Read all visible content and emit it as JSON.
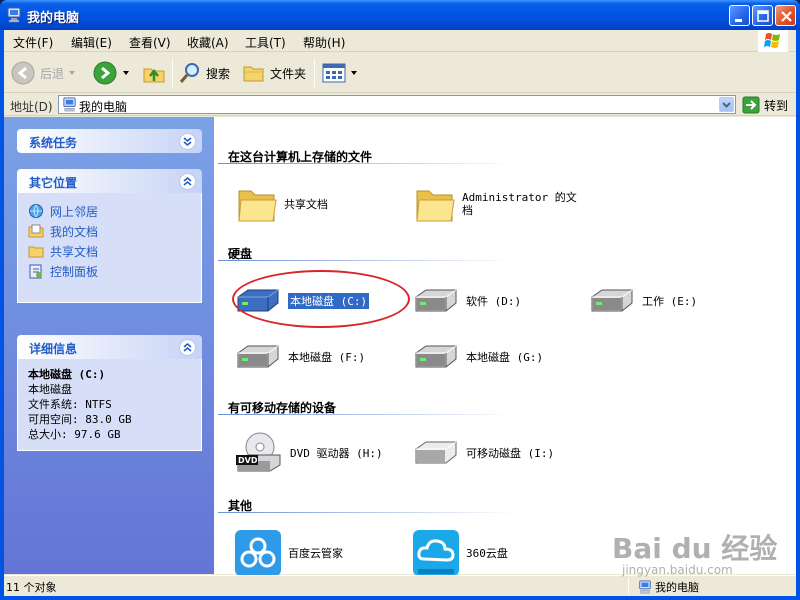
{
  "window": {
    "title": "我的电脑",
    "colors": {
      "titlebar": "#0055e5",
      "taskpane": "#6d8ee0",
      "link": "#215dc6",
      "selection": "#316ac5",
      "highlight_circle": "#d8252a"
    }
  },
  "menu": {
    "items": [
      "文件(F)",
      "编辑(E)",
      "查看(V)",
      "收藏(A)",
      "工具(T)",
      "帮助(H)"
    ]
  },
  "toolbar": {
    "back_label": "后退",
    "search_label": "搜索",
    "folders_label": "文件夹"
  },
  "address": {
    "label": "地址(D)",
    "value": "我的电脑",
    "go_label": "转到"
  },
  "taskpane": {
    "system_tasks_title": "系统任务",
    "other_places_title": "其它位置",
    "other_places": [
      "网上邻居",
      "我的文档",
      "共享文档",
      "控制面板"
    ],
    "details_title": "详细信息",
    "details": {
      "name": "本地磁盘 (C:)",
      "type": "本地磁盘",
      "filesystem": "文件系统: NTFS",
      "free": "可用空间: 83.0 GB",
      "total": "总大小: 97.6 GB"
    }
  },
  "content": {
    "groups": {
      "files": "在这台计算机上存储的文件",
      "hard_disks": "硬盘",
      "removable": "有可移动存储的设备",
      "other": "其他"
    },
    "files_items": [
      "共享文档",
      "Administrator 的文档"
    ],
    "disks": [
      "本地磁盘 (C:)",
      "软件 (D:)",
      "工作 (E:)",
      "本地磁盘 (F:)",
      "本地磁盘 (G:)"
    ],
    "removable_items": [
      "DVD 驱动器 (H:)",
      "可移动磁盘 (I:)"
    ],
    "other_items": [
      "百度云管家",
      "360云盘"
    ],
    "selected_item": "本地磁盘 (C:)"
  },
  "statusbar": {
    "count": "11 个对象",
    "location": "我的电脑"
  },
  "watermark": {
    "main": "Bai du 经验",
    "sub": "jingyan.baidu.com"
  }
}
